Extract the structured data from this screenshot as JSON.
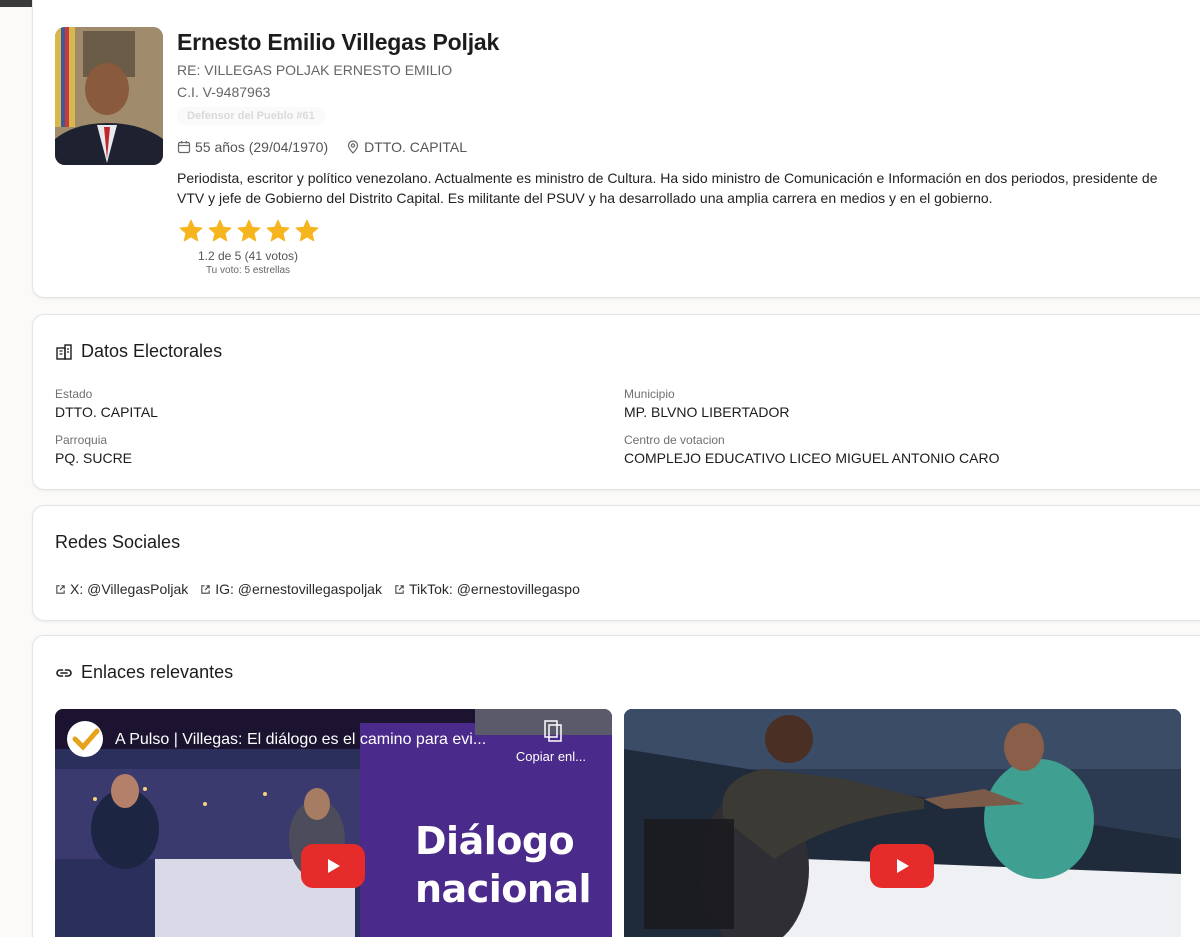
{
  "profile": {
    "name": "Ernesto Emilio Villegas Poljak",
    "re": "RE: VILLEGAS POLJAK ERNESTO EMILIO",
    "ci": "C.I. V-9487963",
    "badge": "Defensor del Pueblo #61",
    "age": "55 años (29/04/1970)",
    "location": "DTTO. CAPITAL",
    "bio": "Periodista, escritor y político venezolano. Actualmente es ministro de Cultura. Ha sido ministro de Comunicación e Información en dos periodos, presidente de VTV y jefe de Gobierno del Distrito Capital. Es militante del PSUV y ha desarrollado una amplia carrera en medios y en el gobierno.",
    "stars": 5,
    "rating_text": "1.2 de 5 (41 votos)",
    "vote_text": "Tu voto: 5 estrellas",
    "star_color": "#f6b51e"
  },
  "electoral": {
    "title": "Datos Electorales",
    "estado_label": "Estado",
    "estado_value": "DTTO. CAPITAL",
    "municipio_label": "Municipio",
    "municipio_value": "MP. BLVNO LIBERTADOR",
    "parroquia_label": "Parroquia",
    "parroquia_value": "PQ. SUCRE",
    "centro_label": "Centro de votacion",
    "centro_value": "COMPLEJO EDUCATIVO LICEO MIGUEL ANTONIO CARO"
  },
  "social": {
    "title": "Redes Sociales",
    "links": [
      "X: @VillegasPoljak",
      "IG: @ernestovillegaspoljak",
      "TikTok: @ernestovillegaspo"
    ]
  },
  "links": {
    "title": "Enlaces relevantes",
    "video1_title": "A Pulso | Villegas: El diálogo es el camino para evi...",
    "video1_copy": "Copiar enl...",
    "video1_overlay_1": "Diálogo",
    "video1_overlay_2": "nacional",
    "play_color": "#e62b2b"
  }
}
